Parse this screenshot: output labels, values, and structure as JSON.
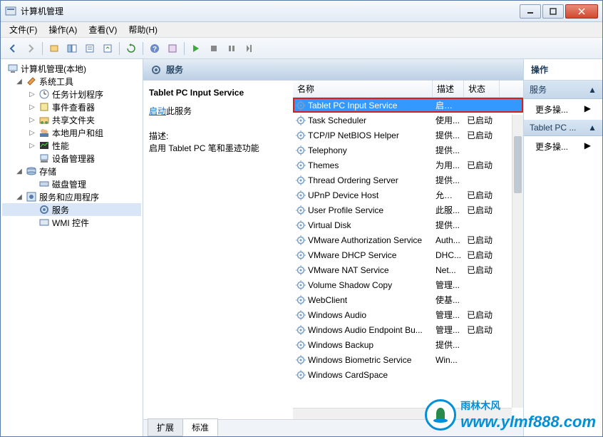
{
  "window": {
    "title": "计算机管理"
  },
  "menu": {
    "file": "文件(F)",
    "action": "操作(A)",
    "view": "查看(V)",
    "help": "帮助(H)"
  },
  "tree": {
    "root": "计算机管理(本地)",
    "sysTools": "系统工具",
    "taskScheduler": "任务计划程序",
    "eventViewer": "事件查看器",
    "sharedFolders": "共享文件夹",
    "localUsers": "本地用户和组",
    "performance": "性能",
    "deviceManager": "设备管理器",
    "storage": "存储",
    "diskMgmt": "磁盘管理",
    "servicesApps": "服务和应用程序",
    "services": "服务",
    "wmi": "WMI 控件"
  },
  "mid": {
    "headerTitle": "服务",
    "selectedTitle": "Tablet PC Input Service",
    "startLink": "启动",
    "startSuffix": "此服务",
    "descLabel": "描述:",
    "descText": "启用 Tablet PC 笔和墨迹功能"
  },
  "columns": {
    "name": "名称",
    "desc": "描述",
    "state": "状态"
  },
  "services": [
    {
      "name": "Tablet PC Input Service",
      "desc": "启用 ...",
      "state": "",
      "selected": true,
      "highlighted": true
    },
    {
      "name": "Task Scheduler",
      "desc": "使用...",
      "state": "已启动"
    },
    {
      "name": "TCP/IP NetBIOS Helper",
      "desc": "提供...",
      "state": "已启动"
    },
    {
      "name": "Telephony",
      "desc": "提供...",
      "state": ""
    },
    {
      "name": "Themes",
      "desc": "为用...",
      "state": "已启动"
    },
    {
      "name": "Thread Ordering Server",
      "desc": "提供...",
      "state": ""
    },
    {
      "name": "UPnP Device Host",
      "desc": "允许 ...",
      "state": "已启动"
    },
    {
      "name": "User Profile Service",
      "desc": "此服...",
      "state": "已启动"
    },
    {
      "name": "Virtual Disk",
      "desc": "提供...",
      "state": ""
    },
    {
      "name": "VMware Authorization Service",
      "desc": "Auth...",
      "state": "已启动"
    },
    {
      "name": "VMware DHCP Service",
      "desc": "DHC...",
      "state": "已启动"
    },
    {
      "name": "VMware NAT Service",
      "desc": "Net...",
      "state": "已启动"
    },
    {
      "name": "Volume Shadow Copy",
      "desc": "管理...",
      "state": ""
    },
    {
      "name": "WebClient",
      "desc": "使基...",
      "state": ""
    },
    {
      "name": "Windows Audio",
      "desc": "管理...",
      "state": "已启动"
    },
    {
      "name": "Windows Audio Endpoint Bu...",
      "desc": "管理...",
      "state": "已启动"
    },
    {
      "name": "Windows Backup",
      "desc": "提供...",
      "state": ""
    },
    {
      "name": "Windows Biometric Service",
      "desc": "Win...",
      "state": ""
    },
    {
      "name": "Windows CardSpace",
      "desc": "",
      "state": ""
    }
  ],
  "tabs": {
    "extended": "扩展",
    "standard": "标准"
  },
  "actions": {
    "header": "操作",
    "section1": "服务",
    "more": "更多操...",
    "section2": "Tablet PC ..."
  },
  "watermark": {
    "cn": "雨林木风",
    "en": "www.ylmf888.com"
  }
}
